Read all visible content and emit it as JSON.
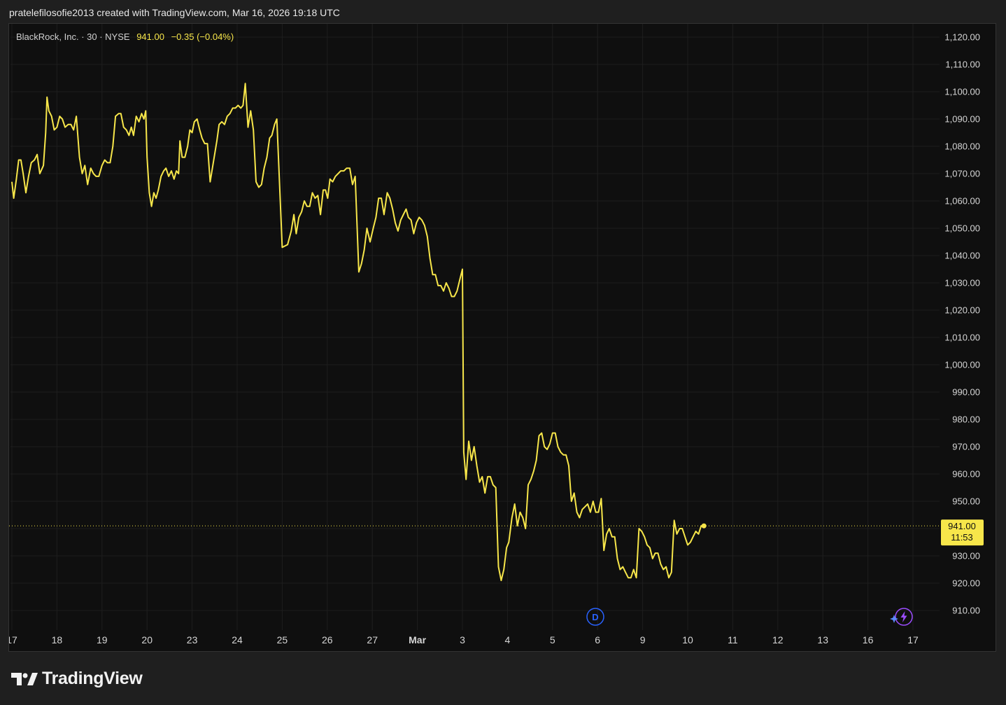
{
  "header": {
    "attribution": "pratelefilosofie2013 created with TradingView.com, Mar 16, 2026 19:18 UTC"
  },
  "legend": {
    "symbol": "BlackRock, Inc. · 30 · NYSE",
    "last": "941.00",
    "change": "−0.35 (−0.04%)"
  },
  "price_label": {
    "price": "941.00",
    "countdown": "11:53"
  },
  "markers": {
    "dividend": "D"
  },
  "brand": {
    "name": "TradingView"
  },
  "colors": {
    "line": "#f7e64a",
    "background": "#0f0f0f",
    "grid": "#1e1e1e",
    "axis_text": "#d6d6d6",
    "dividend": "#2962ff",
    "bolt": "#9c4dff"
  },
  "icons": {
    "logo": "tradingview-logo-icon",
    "dividend": "dividend-marker-icon",
    "alert": "lightning-bolt-icon"
  },
  "chart_data": {
    "type": "line",
    "title": "BlackRock, Inc. · 30 · NYSE",
    "xlabel": "",
    "ylabel": "",
    "ylim": [
      904,
      1124
    ],
    "grid": true,
    "x_ticks": [
      {
        "label": "17",
        "i": 0
      },
      {
        "label": "18",
        "i": 1
      },
      {
        "label": "19",
        "i": 2
      },
      {
        "label": "20",
        "i": 3
      },
      {
        "label": "23",
        "i": 4
      },
      {
        "label": "24",
        "i": 5
      },
      {
        "label": "25",
        "i": 6
      },
      {
        "label": "26",
        "i": 7
      },
      {
        "label": "27",
        "i": 8
      },
      {
        "label": "Mar",
        "i": 9
      },
      {
        "label": "3",
        "i": 10
      },
      {
        "label": "4",
        "i": 11
      },
      {
        "label": "5",
        "i": 12
      },
      {
        "label": "6",
        "i": 13
      },
      {
        "label": "9",
        "i": 14
      },
      {
        "label": "10",
        "i": 15
      },
      {
        "label": "11",
        "i": 16
      },
      {
        "label": "12",
        "i": 17
      },
      {
        "label": "13",
        "i": 18
      },
      {
        "label": "16",
        "i": 19
      },
      {
        "label": "17",
        "i": 20
      }
    ],
    "y_ticks": [
      910,
      920,
      930,
      940,
      950,
      960,
      970,
      980,
      990,
      1000,
      1010,
      1020,
      1030,
      1040,
      1050,
      1060,
      1070,
      1080,
      1090,
      1100,
      1110,
      1120
    ],
    "y_tick_labels": [
      "910.00",
      "920.00",
      "930.00",
      "940.00",
      "950.00",
      "960.00",
      "970.00",
      "980.00",
      "990.00",
      "1,000.00",
      "1,010.00",
      "1,020.00",
      "1,030.00",
      "1,040.00",
      "1,050.00",
      "1,060.00",
      "1,070.00",
      "1,080.00",
      "1,090.00",
      "1,100.00",
      "1,110.00",
      "1,120.00"
    ],
    "current_price": 941.0,
    "series": [
      {
        "values": [
          [
            0.0,
            1067
          ],
          [
            0.04,
            1061
          ],
          [
            0.1,
            1068
          ],
          [
            0.15,
            1075
          ],
          [
            0.2,
            1075
          ],
          [
            0.25,
            1070
          ],
          [
            0.31,
            1063
          ],
          [
            0.37,
            1069
          ],
          [
            0.43,
            1074
          ],
          [
            0.5,
            1075
          ],
          [
            0.56,
            1077
          ],
          [
            0.62,
            1070
          ],
          [
            0.7,
            1073
          ],
          [
            0.75,
            1085
          ],
          [
            0.78,
            1098
          ],
          [
            0.82,
            1093
          ],
          [
            0.88,
            1091
          ],
          [
            0.94,
            1086
          ],
          [
            1.0,
            1087
          ],
          [
            1.06,
            1091
          ],
          [
            1.12,
            1090
          ],
          [
            1.18,
            1087
          ],
          [
            1.25,
            1088
          ],
          [
            1.31,
            1088
          ],
          [
            1.37,
            1086
          ],
          [
            1.43,
            1091
          ],
          [
            1.5,
            1076
          ],
          [
            1.56,
            1070
          ],
          [
            1.62,
            1073
          ],
          [
            1.68,
            1066
          ],
          [
            1.75,
            1072
          ],
          [
            1.81,
            1070
          ],
          [
            1.87,
            1069
          ],
          [
            1.93,
            1069
          ],
          [
            2.0,
            1073
          ],
          [
            2.06,
            1075
          ],
          [
            2.12,
            1074
          ],
          [
            2.18,
            1074
          ],
          [
            2.24,
            1080
          ],
          [
            2.3,
            1091
          ],
          [
            2.37,
            1092
          ],
          [
            2.42,
            1092
          ],
          [
            2.48,
            1087
          ],
          [
            2.54,
            1086
          ],
          [
            2.6,
            1084
          ],
          [
            2.65,
            1087
          ],
          [
            2.7,
            1084
          ],
          [
            2.76,
            1091
          ],
          [
            2.82,
            1089
          ],
          [
            2.88,
            1092
          ],
          [
            2.93,
            1090
          ],
          [
            2.97,
            1093
          ],
          [
            3.0,
            1076
          ],
          [
            3.05,
            1063
          ],
          [
            3.1,
            1058
          ],
          [
            3.15,
            1063
          ],
          [
            3.2,
            1061
          ],
          [
            3.25,
            1064
          ],
          [
            3.31,
            1069
          ],
          [
            3.37,
            1071
          ],
          [
            3.42,
            1072
          ],
          [
            3.48,
            1069
          ],
          [
            3.54,
            1071
          ],
          [
            3.6,
            1068
          ],
          [
            3.65,
            1071
          ],
          [
            3.7,
            1070
          ],
          [
            3.73,
            1082
          ],
          [
            3.78,
            1076
          ],
          [
            3.84,
            1076
          ],
          [
            3.9,
            1080
          ],
          [
            3.95,
            1086
          ],
          [
            4.0,
            1085
          ],
          [
            4.05,
            1089
          ],
          [
            4.11,
            1090
          ],
          [
            4.17,
            1086
          ],
          [
            4.22,
            1083
          ],
          [
            4.28,
            1081
          ],
          [
            4.34,
            1081
          ],
          [
            4.4,
            1067
          ],
          [
            4.45,
            1072
          ],
          [
            4.5,
            1077
          ],
          [
            4.55,
            1082
          ],
          [
            4.6,
            1088
          ],
          [
            4.66,
            1089
          ],
          [
            4.72,
            1088
          ],
          [
            4.78,
            1091
          ],
          [
            4.84,
            1092
          ],
          [
            4.9,
            1094
          ],
          [
            4.96,
            1094
          ],
          [
            5.02,
            1095
          ],
          [
            5.08,
            1094
          ],
          [
            5.13,
            1095
          ],
          [
            5.18,
            1103
          ],
          [
            5.24,
            1087
          ],
          [
            5.3,
            1093
          ],
          [
            5.36,
            1086
          ],
          [
            5.42,
            1067
          ],
          [
            5.48,
            1065
          ],
          [
            5.54,
            1066
          ],
          [
            5.6,
            1072
          ],
          [
            5.66,
            1076
          ],
          [
            5.72,
            1083
          ],
          [
            5.77,
            1084
          ],
          [
            5.83,
            1088
          ],
          [
            5.88,
            1090
          ],
          [
            6.0,
            1043
          ],
          [
            6.12,
            1044
          ],
          [
            6.2,
            1049
          ],
          [
            6.26,
            1055
          ],
          [
            6.31,
            1048
          ],
          [
            6.37,
            1054
          ],
          [
            6.43,
            1056
          ],
          [
            6.49,
            1060
          ],
          [
            6.55,
            1058
          ],
          [
            6.61,
            1058
          ],
          [
            6.67,
            1063
          ],
          [
            6.73,
            1061
          ],
          [
            6.79,
            1062
          ],
          [
            6.85,
            1055
          ],
          [
            6.91,
            1064
          ],
          [
            6.96,
            1064
          ],
          [
            7.01,
            1061
          ],
          [
            7.06,
            1068
          ],
          [
            7.12,
            1067
          ],
          [
            7.18,
            1069
          ],
          [
            7.24,
            1070
          ],
          [
            7.3,
            1071
          ],
          [
            7.37,
            1071
          ],
          [
            7.43,
            1072
          ],
          [
            7.5,
            1072
          ],
          [
            7.56,
            1066
          ],
          [
            7.62,
            1069
          ],
          [
            7.7,
            1034
          ],
          [
            7.76,
            1037
          ],
          [
            7.82,
            1042
          ],
          [
            7.88,
            1050
          ],
          [
            7.95,
            1045
          ],
          [
            8.02,
            1050
          ],
          [
            8.08,
            1054
          ],
          [
            8.14,
            1061
          ],
          [
            8.2,
            1061
          ],
          [
            8.26,
            1055
          ],
          [
            8.33,
            1063
          ],
          [
            8.39,
            1061
          ],
          [
            8.45,
            1057
          ],
          [
            8.51,
            1052
          ],
          [
            8.57,
            1049
          ],
          [
            8.63,
            1053
          ],
          [
            8.69,
            1055
          ],
          [
            8.75,
            1057
          ],
          [
            8.8,
            1054
          ],
          [
            8.86,
            1053
          ],
          [
            8.92,
            1048
          ],
          [
            8.98,
            1052
          ],
          [
            9.04,
            1054
          ],
          [
            9.1,
            1053
          ],
          [
            9.16,
            1051
          ],
          [
            9.22,
            1047
          ],
          [
            9.28,
            1039
          ],
          [
            9.34,
            1033
          ],
          [
            9.4,
            1033
          ],
          [
            9.46,
            1029
          ],
          [
            9.52,
            1029
          ],
          [
            9.58,
            1027
          ],
          [
            9.64,
            1030
          ],
          [
            9.7,
            1028
          ],
          [
            9.76,
            1025
          ],
          [
            9.82,
            1025
          ],
          [
            9.88,
            1027
          ],
          [
            9.94,
            1031
          ],
          [
            10.0,
            1035
          ],
          [
            10.03,
            968
          ],
          [
            10.08,
            958
          ],
          [
            10.14,
            972
          ],
          [
            10.2,
            965
          ],
          [
            10.26,
            970
          ],
          [
            10.32,
            963
          ],
          [
            10.38,
            957
          ],
          [
            10.44,
            959
          ],
          [
            10.5,
            953
          ],
          [
            10.56,
            959
          ],
          [
            10.62,
            959
          ],
          [
            10.68,
            956
          ],
          [
            10.74,
            955
          ],
          [
            10.8,
            926
          ],
          [
            10.86,
            921
          ],
          [
            10.92,
            925
          ],
          [
            10.98,
            933
          ],
          [
            11.03,
            935
          ],
          [
            11.1,
            944
          ],
          [
            11.16,
            949
          ],
          [
            11.22,
            941
          ],
          [
            11.28,
            946
          ],
          [
            11.34,
            944
          ],
          [
            11.4,
            940
          ],
          [
            11.46,
            956
          ],
          [
            11.52,
            958
          ],
          [
            11.58,
            961
          ],
          [
            11.64,
            965
          ],
          [
            11.7,
            974
          ],
          [
            11.76,
            975
          ],
          [
            11.82,
            970
          ],
          [
            11.88,
            969
          ],
          [
            11.94,
            971
          ],
          [
            12.0,
            975
          ],
          [
            12.06,
            975
          ],
          [
            12.12,
            970
          ],
          [
            12.18,
            968
          ],
          [
            12.24,
            967
          ],
          [
            12.3,
            967
          ],
          [
            12.36,
            963
          ],
          [
            12.42,
            950
          ],
          [
            12.48,
            953
          ],
          [
            12.54,
            946
          ],
          [
            12.6,
            944
          ],
          [
            12.66,
            947
          ],
          [
            12.72,
            948
          ],
          [
            12.78,
            949
          ],
          [
            12.84,
            946
          ],
          [
            12.9,
            950
          ],
          [
            12.96,
            946
          ],
          [
            13.02,
            946
          ],
          [
            13.08,
            951
          ],
          [
            13.14,
            932
          ],
          [
            13.2,
            938
          ],
          [
            13.26,
            940
          ],
          [
            13.32,
            937
          ],
          [
            13.38,
            937
          ],
          [
            13.44,
            929
          ],
          [
            13.5,
            925
          ],
          [
            13.56,
            926
          ],
          [
            13.62,
            924
          ],
          [
            13.68,
            922
          ],
          [
            13.74,
            922
          ],
          [
            13.8,
            925
          ],
          [
            13.86,
            922
          ],
          [
            13.92,
            940
          ],
          [
            13.98,
            939
          ],
          [
            14.04,
            937
          ],
          [
            14.1,
            934
          ],
          [
            14.16,
            933
          ],
          [
            14.22,
            929
          ],
          [
            14.28,
            931
          ],
          [
            14.34,
            931
          ],
          [
            14.4,
            927
          ],
          [
            14.46,
            925
          ],
          [
            14.52,
            926
          ],
          [
            14.58,
            922
          ],
          [
            14.64,
            924
          ],
          [
            14.7,
            943
          ],
          [
            14.76,
            938
          ],
          [
            14.82,
            940
          ],
          [
            14.88,
            940
          ],
          [
            14.94,
            937
          ],
          [
            15.0,
            934
          ],
          [
            15.06,
            935
          ],
          [
            15.12,
            937
          ],
          [
            15.18,
            939
          ],
          [
            15.24,
            938
          ],
          [
            15.3,
            941
          ],
          [
            15.36,
            941
          ]
        ]
      }
    ]
  }
}
